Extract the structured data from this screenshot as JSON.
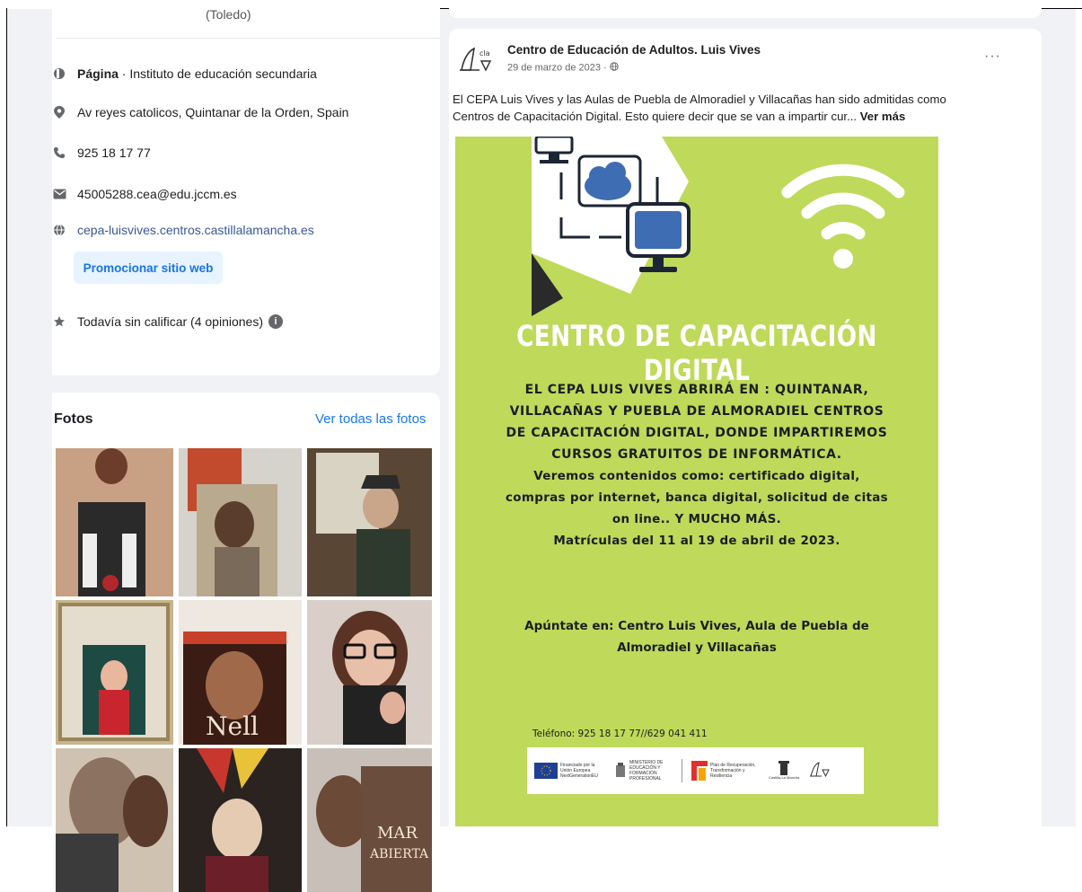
{
  "about": {
    "location_suffix": "(Toledo)",
    "page_type_label": "Página",
    "page_type_value": " · Instituto de educación secundaria",
    "address": "Av reyes catolicos, Quintanar de la Orden, Spain",
    "phone": "925 18 17 77",
    "email": "45005288.cea@edu.jccm.es",
    "website": "cepa-luisvives.centros.castillalamancha.es",
    "promote_button": "Promocionar sitio web",
    "rating": "Todavía sin calificar (4 opiniones)",
    "rating_info_icon": "i"
  },
  "photos": {
    "title": "Fotos",
    "see_all": "Ver todas las fotos"
  },
  "post": {
    "page_name": "Centro de Educación de Adultos. Luis Vives",
    "date": "29 de marzo de 2023 · ",
    "more_menu": "···",
    "text": "El CEPA Luis Vives y las Aulas de Puebla de Almoradiel y Villacañas han sido admitidas como Centros de Capacitación Digital. Esto quiere decir que se van a impartir cur... ",
    "see_more": "Ver más"
  },
  "poster": {
    "title": "CENTRO DE CAPACITACIÓN DIGITAL",
    "body_lines": [
      "EL CEPA LUIS VIVES ABRIRÁ EN : QUINTANAR,",
      "VILLACAÑAS Y PUEBLA DE ALMORADIEL CENTROS",
      "DE CAPACITACIÓN DIGITAL,  DONDE IMPARTIREMOS",
      "CURSOS GRATUITOS DE INFORMÁTICA.",
      "Veremos contenidos como: certificado digital,",
      "compras por internet, banca digital, solicitud de citas",
      "on line.. Y MUCHO MÁS.",
      "Matrículas del 11 al 19 de abril de 2023."
    ],
    "apuntate_lines": [
      "Apúntate en: Centro Luis Vives, Aula de Puebla de",
      "Almoradiel y Villacañas"
    ],
    "phone": "Teléfono: 925 18 17 77//629 041 411",
    "logos": {
      "eu": "Financiado por la Unión Europea NextGenerationEU",
      "ministry": "MINISTERIO DE EDUCACIÓN Y FORMACIÓN PROFESIONAL",
      "plan": "Plan de Recuperación, Transformación y Resiliencia",
      "region": "Castilla-La Mancha"
    }
  },
  "colors": {
    "accent": "#1877f2",
    "poster_bg": "#bfd95a",
    "promo_bg": "#e7f3ff"
  },
  "icons": [
    "page-icon",
    "location-icon",
    "phone-icon",
    "email-icon",
    "globe-icon",
    "star-icon",
    "wifi-icon",
    "cloud-icon",
    "monitor-icon",
    "globe-privacy-icon",
    "more-icon"
  ]
}
